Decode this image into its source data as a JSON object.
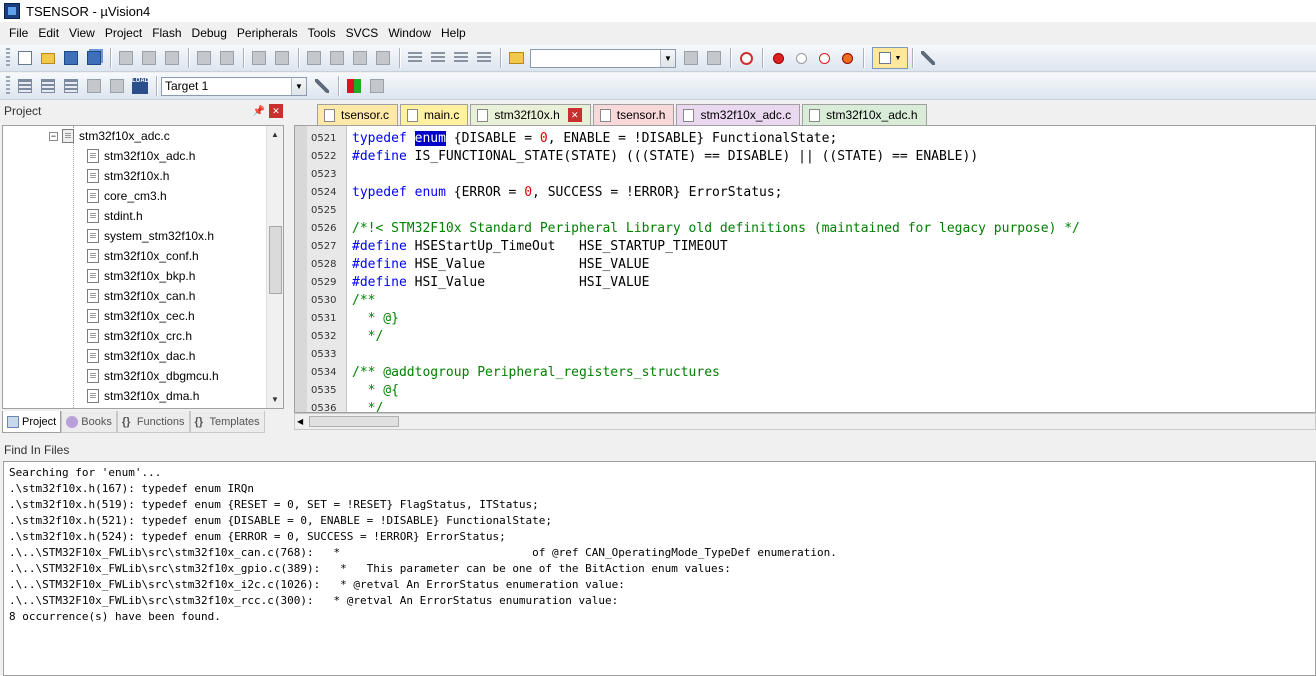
{
  "window": {
    "title": "TSENSOR - µVision4"
  },
  "menu": [
    "File",
    "Edit",
    "View",
    "Project",
    "Flash",
    "Debug",
    "Peripherals",
    "Tools",
    "SVCS",
    "Window",
    "Help"
  ],
  "toolbar": {
    "find_value": "",
    "target": "Target 1",
    "load_label": "LOAD"
  },
  "project_panel": {
    "title": "Project",
    "group": "stm32f10x_adc.c",
    "files": [
      "stm32f10x_adc.h",
      "stm32f10x.h",
      "core_cm3.h",
      "stdint.h",
      "system_stm32f10x.h",
      "stm32f10x_conf.h",
      "stm32f10x_bkp.h",
      "stm32f10x_can.h",
      "stm32f10x_cec.h",
      "stm32f10x_crc.h",
      "stm32f10x_dac.h",
      "stm32f10x_dbgmcu.h",
      "stm32f10x_dma.h"
    ],
    "tabs": [
      "Project",
      "Books",
      "Functions",
      "Templates"
    ]
  },
  "editor": {
    "tabs": [
      {
        "label": "tsensor.c",
        "color": "#ffe9a8"
      },
      {
        "label": "main.c",
        "color": "#fff1a0"
      },
      {
        "label": "stm32f10x.h",
        "color": "#e8f0d8"
      },
      {
        "label": "tsensor.h",
        "color": "#f8d8d8"
      },
      {
        "label": "stm32f10x_adc.c",
        "color": "#ead8f0"
      },
      {
        "label": "stm32f10x_adc.h",
        "color": "#d8ecd8"
      }
    ],
    "active_tab": "stm32f10x.h",
    "lines": [
      {
        "n": "0521",
        "html": "<span class='kw'>typedef</span> <span class='sel'>enum</span> {DISABLE = <span class='num'>0</span>, ENABLE = !DISABLE} FunctionalState;"
      },
      {
        "n": "0522",
        "html": "<span class='kw'>#define</span> IS_FUNCTIONAL_STATE(STATE) (((STATE) == DISABLE) || ((STATE) == ENABLE))"
      },
      {
        "n": "0523",
        "html": ""
      },
      {
        "n": "0524",
        "html": "<span class='kw'>typedef</span> <span class='kw'>enum</span> {ERROR = <span class='num'>0</span>, SUCCESS = !ERROR} ErrorStatus;"
      },
      {
        "n": "0525",
        "html": ""
      },
      {
        "n": "0526",
        "html": "<span class='cm'>/*!&lt; STM32F10x Standard Peripheral Library old definitions (maintained for legacy purpose) */</span>"
      },
      {
        "n": "0527",
        "html": "<span class='kw'>#define</span> HSEStartUp_TimeOut   HSE_STARTUP_TIMEOUT"
      },
      {
        "n": "0528",
        "html": "<span class='kw'>#define</span> HSE_Value            HSE_VALUE"
      },
      {
        "n": "0529",
        "html": "<span class='kw'>#define</span> HSI_Value            HSI_VALUE"
      },
      {
        "n": "0530",
        "html": "<span class='cm'>/**</span>"
      },
      {
        "n": "0531",
        "html": "<span class='cm'>  * @}</span>"
      },
      {
        "n": "0532",
        "html": "<span class='cm'>  */</span>"
      },
      {
        "n": "0533",
        "html": ""
      },
      {
        "n": "0534",
        "html": "<span class='cm'>/** @addtogroup Peripheral_registers_structures</span>"
      },
      {
        "n": "0535",
        "html": "<span class='cm'>  * @{</span>"
      },
      {
        "n": "0536",
        "html": "<span class='cm'>  */</span>"
      }
    ]
  },
  "find_panel": {
    "title": "Find In Files",
    "lines": [
      "Searching for 'enum'...",
      ".\\stm32f10x.h(167): typedef enum IRQn",
      ".\\stm32f10x.h(519): typedef enum {RESET = 0, SET = !RESET} FlagStatus, ITStatus;",
      ".\\stm32f10x.h(521): typedef enum {DISABLE = 0, ENABLE = !DISABLE} FunctionalState;",
      ".\\stm32f10x.h(524): typedef enum {ERROR = 0, SUCCESS = !ERROR} ErrorStatus;",
      ".\\..\\STM32F10x_FWLib\\src\\stm32f10x_can.c(768):   *                             of @ref CAN_OperatingMode_TypeDef enumeration.",
      ".\\..\\STM32F10x_FWLib\\src\\stm32f10x_gpio.c(389):   *   This parameter can be one of the BitAction enum values:",
      ".\\..\\STM32F10x_FWLib\\src\\stm32f10x_i2c.c(1026):   * @retval An ErrorStatus enumeration value:",
      ".\\..\\STM32F10x_FWLib\\src\\stm32f10x_rcc.c(300):   * @retval An ErrorStatus enumuration value:",
      "8 occurrence(s) have been found."
    ]
  }
}
